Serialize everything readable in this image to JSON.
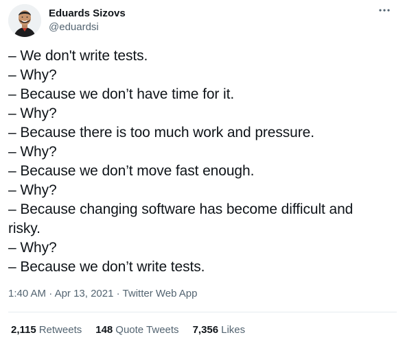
{
  "author": {
    "display_name": "Eduards Sizovs",
    "handle": "@eduardsi",
    "avatar_icon": "user-avatar"
  },
  "more_icon": "ellipsis-icon",
  "tweet": {
    "lines": [
      "– We don't write tests.",
      "– Why?",
      "– Because we don’t have time for it.",
      "– Why?",
      "– Because there is too much work and pressure.",
      "– Why?",
      "– Because we don’t move fast enough.",
      "– Why?",
      "– Because changing software has become difficult and",
      "risky.",
      "– Why?",
      "– Because we don’t write tests."
    ]
  },
  "meta": {
    "time": "1:40 AM",
    "separator": " · ",
    "date": "Apr 13, 2021",
    "source": "Twitter Web App"
  },
  "stats": {
    "retweets_count": "2,115",
    "retweets_label": "Retweets",
    "quotes_count": "148",
    "quotes_label": "Quote Tweets",
    "likes_count": "7,356",
    "likes_label": "Likes"
  },
  "colors": {
    "text_primary": "#0f1419",
    "text_secondary": "#536471",
    "divider": "#e6ecf0"
  }
}
